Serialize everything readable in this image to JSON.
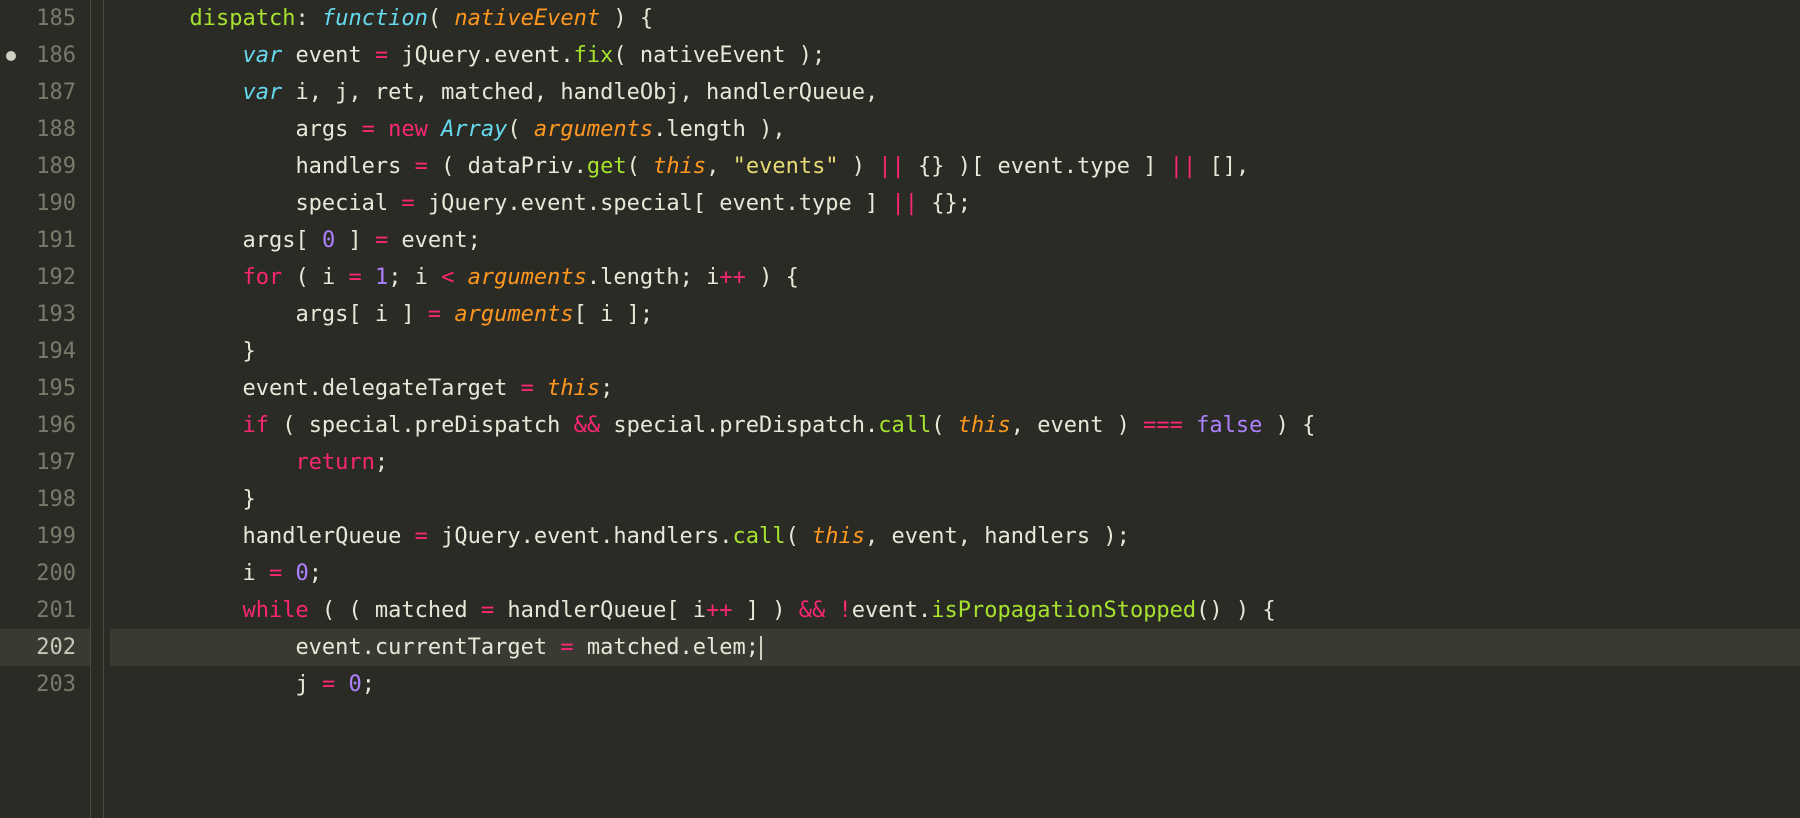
{
  "gutter": {
    "start": 185,
    "end": 203,
    "breakpoint_line": 186,
    "current_line": 202
  },
  "code": {
    "lines": [
      {
        "n": 185,
        "indent": "      ",
        "tokens": [
          [
            "fn",
            "dispatch"
          ],
          [
            "pn",
            ": "
          ],
          [
            "st",
            "function"
          ],
          [
            "pn",
            "( "
          ],
          [
            "prm",
            "nativeEvent"
          ],
          [
            "pn",
            " ) {"
          ]
        ]
      },
      {
        "n": 186,
        "indent": "          ",
        "tokens": [
          [
            "st",
            "var"
          ],
          [
            "pn",
            " event "
          ],
          [
            "op",
            "="
          ],
          [
            "pn",
            " jQuery.event."
          ],
          [
            "fn",
            "fix"
          ],
          [
            "pn",
            "( nativeEvent );"
          ]
        ]
      },
      {
        "n": 187,
        "indent": "          ",
        "tokens": [
          [
            "st",
            "var"
          ],
          [
            "pn",
            " i, j, ret, matched, handleObj, handlerQueue,"
          ]
        ]
      },
      {
        "n": 188,
        "indent": "              ",
        "tokens": [
          [
            "pn",
            "args "
          ],
          [
            "op",
            "="
          ],
          [
            "pn",
            " "
          ],
          [
            "kw",
            "new"
          ],
          [
            "pn",
            " "
          ],
          [
            "st",
            "Array"
          ],
          [
            "pn",
            "( "
          ],
          [
            "prm",
            "arguments"
          ],
          [
            "pn",
            ".length ),"
          ]
        ]
      },
      {
        "n": 189,
        "indent": "              ",
        "tokens": [
          [
            "pn",
            "handlers "
          ],
          [
            "op",
            "="
          ],
          [
            "pn",
            " ( dataPriv."
          ],
          [
            "fn",
            "get"
          ],
          [
            "pn",
            "( "
          ],
          [
            "prm",
            "this"
          ],
          [
            "pn",
            ", "
          ],
          [
            "str",
            "\"events\""
          ],
          [
            "pn",
            " ) "
          ],
          [
            "op",
            "||"
          ],
          [
            "pn",
            " {} )[ event.type ] "
          ],
          [
            "op",
            "||"
          ],
          [
            "pn",
            " [],"
          ]
        ]
      },
      {
        "n": 190,
        "indent": "              ",
        "tokens": [
          [
            "pn",
            "special "
          ],
          [
            "op",
            "="
          ],
          [
            "pn",
            " jQuery.event.special[ event.type ] "
          ],
          [
            "op",
            "||"
          ],
          [
            "pn",
            " {};"
          ]
        ]
      },
      {
        "n": 191,
        "indent": "          ",
        "tokens": [
          [
            "pn",
            "args[ "
          ],
          [
            "num",
            "0"
          ],
          [
            "pn",
            " ] "
          ],
          [
            "op",
            "="
          ],
          [
            "pn",
            " event;"
          ]
        ]
      },
      {
        "n": 192,
        "indent": "          ",
        "tokens": [
          [
            "kw",
            "for"
          ],
          [
            "pn",
            " ( i "
          ],
          [
            "op",
            "="
          ],
          [
            "pn",
            " "
          ],
          [
            "num",
            "1"
          ],
          [
            "pn",
            "; i "
          ],
          [
            "op",
            "<"
          ],
          [
            "pn",
            " "
          ],
          [
            "prm",
            "arguments"
          ],
          [
            "pn",
            ".length; i"
          ],
          [
            "op",
            "++"
          ],
          [
            "pn",
            " ) {"
          ]
        ]
      },
      {
        "n": 193,
        "indent": "              ",
        "tokens": [
          [
            "pn",
            "args[ i ] "
          ],
          [
            "op",
            "="
          ],
          [
            "pn",
            " "
          ],
          [
            "prm",
            "arguments"
          ],
          [
            "pn",
            "[ i ];"
          ]
        ]
      },
      {
        "n": 194,
        "indent": "          ",
        "tokens": [
          [
            "pn",
            "}"
          ]
        ]
      },
      {
        "n": 195,
        "indent": "          ",
        "tokens": [
          [
            "pn",
            "event.delegateTarget "
          ],
          [
            "op",
            "="
          ],
          [
            "pn",
            " "
          ],
          [
            "prm",
            "this"
          ],
          [
            "pn",
            ";"
          ]
        ]
      },
      {
        "n": 196,
        "indent": "          ",
        "tokens": [
          [
            "kw",
            "if"
          ],
          [
            "pn",
            " ( special.preDispatch "
          ],
          [
            "op",
            "&&"
          ],
          [
            "pn",
            " special.preDispatch."
          ],
          [
            "fn",
            "call"
          ],
          [
            "pn",
            "( "
          ],
          [
            "prm",
            "this"
          ],
          [
            "pn",
            ", event ) "
          ],
          [
            "op",
            "==="
          ],
          [
            "pn",
            " "
          ],
          [
            "bool",
            "false"
          ],
          [
            "pn",
            " ) {"
          ]
        ]
      },
      {
        "n": 197,
        "indent": "              ",
        "tokens": [
          [
            "kw",
            "return"
          ],
          [
            "pn",
            ";"
          ]
        ]
      },
      {
        "n": 198,
        "indent": "          ",
        "tokens": [
          [
            "pn",
            "}"
          ]
        ]
      },
      {
        "n": 199,
        "indent": "          ",
        "tokens": [
          [
            "pn",
            "handlerQueue "
          ],
          [
            "op",
            "="
          ],
          [
            "pn",
            " jQuery.event.handlers."
          ],
          [
            "fn",
            "call"
          ],
          [
            "pn",
            "( "
          ],
          [
            "prm",
            "this"
          ],
          [
            "pn",
            ", event, handlers );"
          ]
        ]
      },
      {
        "n": 200,
        "indent": "          ",
        "tokens": [
          [
            "pn",
            "i "
          ],
          [
            "op",
            "="
          ],
          [
            "pn",
            " "
          ],
          [
            "num",
            "0"
          ],
          [
            "pn",
            ";"
          ]
        ]
      },
      {
        "n": 201,
        "indent": "          ",
        "tokens": [
          [
            "kw",
            "while"
          ],
          [
            "pn",
            " ( ( matched "
          ],
          [
            "op",
            "="
          ],
          [
            "pn",
            " handlerQueue[ i"
          ],
          [
            "op",
            "++"
          ],
          [
            "pn",
            " ] ) "
          ],
          [
            "op",
            "&&"
          ],
          [
            "pn",
            " "
          ],
          [
            "op",
            "!"
          ],
          [
            "pn",
            "event."
          ],
          [
            "fn",
            "isPropagationStopped"
          ],
          [
            "pn",
            "() ) {"
          ]
        ]
      },
      {
        "n": 202,
        "indent": "              ",
        "tokens": [
          [
            "pn",
            "event.currentTarget "
          ],
          [
            "op",
            "="
          ],
          [
            "pn",
            " matched.elem;"
          ]
        ],
        "cursor": true,
        "current": true
      },
      {
        "n": 203,
        "indent": "              ",
        "tokens": [
          [
            "pn",
            "j "
          ],
          [
            "op",
            "="
          ],
          [
            "pn",
            " "
          ],
          [
            "num",
            "0"
          ],
          [
            "pn",
            ";"
          ]
        ]
      }
    ]
  }
}
